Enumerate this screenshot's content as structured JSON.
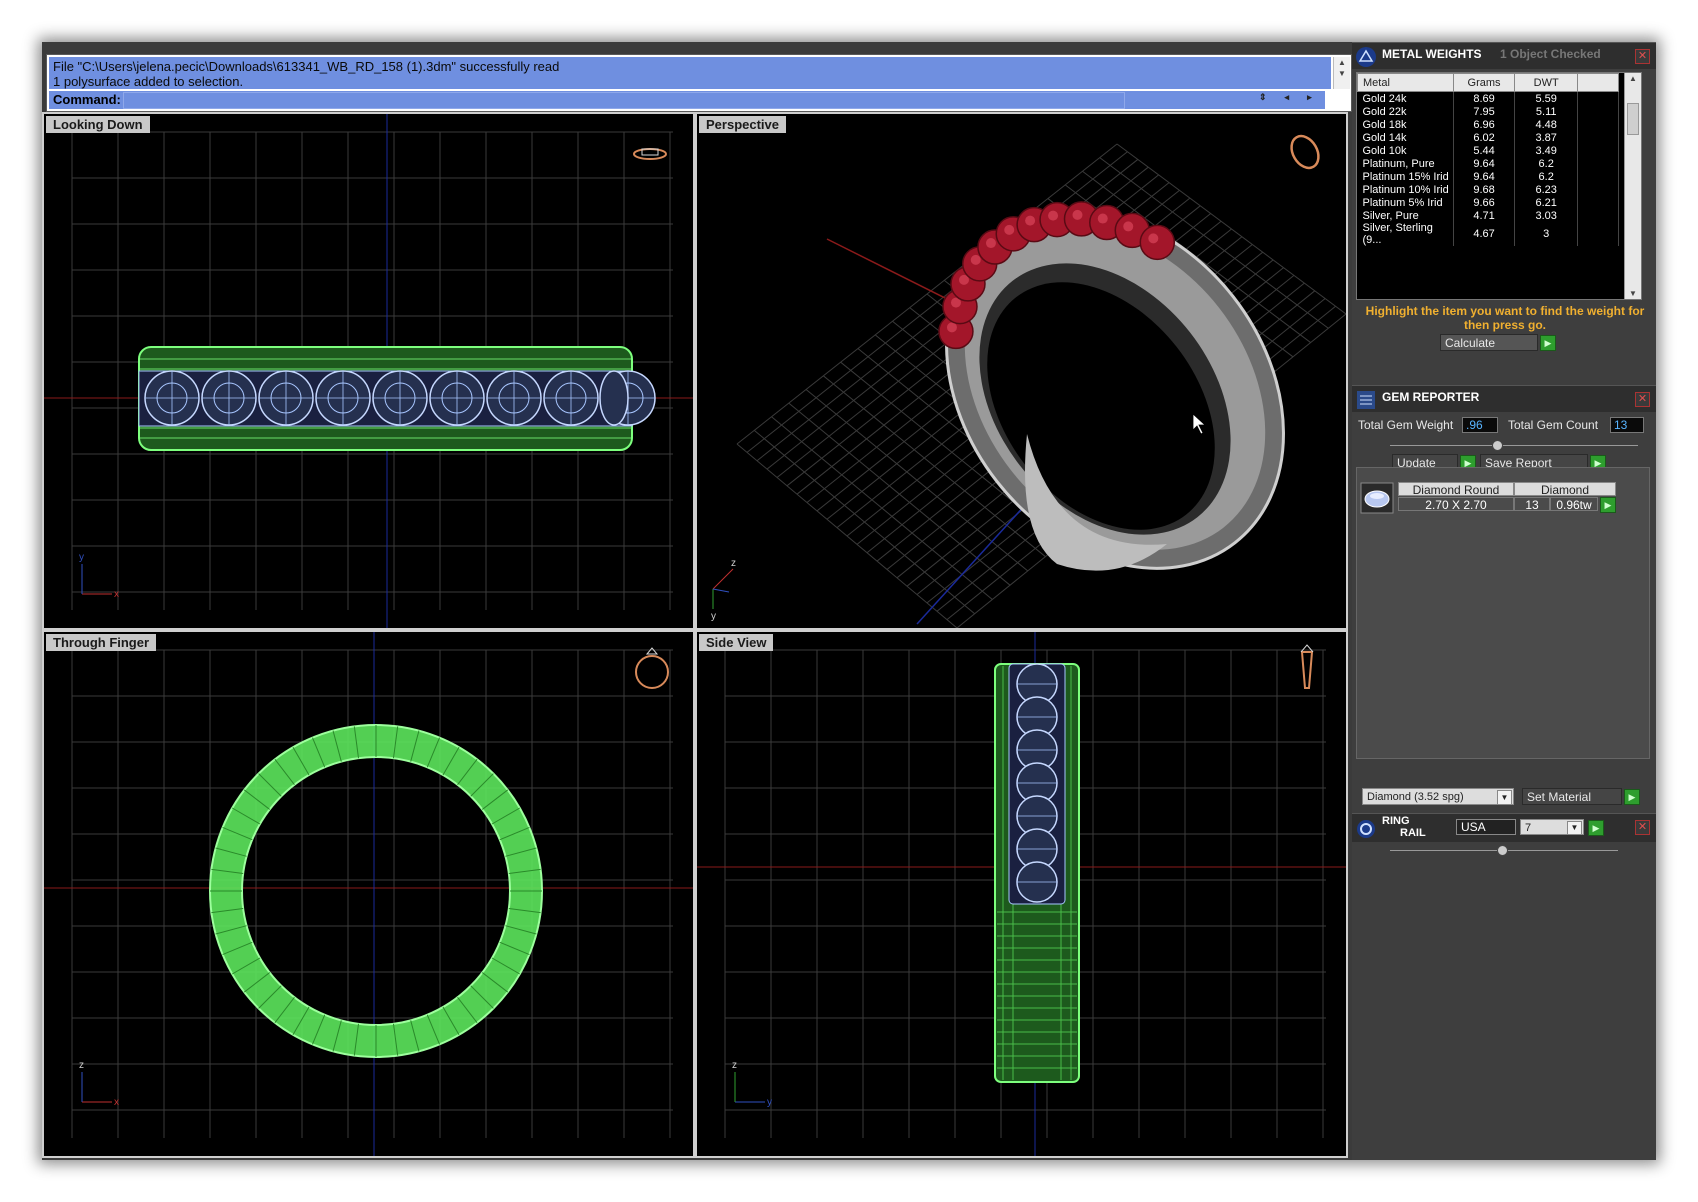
{
  "command": {
    "history": [
      "File \"C:\\Users\\jelena.pecic\\Downloads\\613341_WB_RD_158 (1).3dm\" successfully read",
      "1 polysurface added to selection."
    ],
    "label": "Command:"
  },
  "viewports": {
    "top": "Looking Down",
    "perspective": "Perspective",
    "front": "Through Finger",
    "side": "Side View"
  },
  "axes": {
    "x": "x",
    "y": "y",
    "z": "z"
  },
  "metal_weights": {
    "title": "METAL WEIGHTS",
    "status": "1 Object Checked",
    "columns": [
      "Metal",
      "Grams",
      "DWT"
    ],
    "rows": [
      [
        "Gold 24k",
        "8.69",
        "5.59"
      ],
      [
        "Gold 22k",
        "7.95",
        "5.11"
      ],
      [
        "Gold 18k",
        "6.96",
        "4.48"
      ],
      [
        "Gold 14k",
        "6.02",
        "3.87"
      ],
      [
        "Gold 10k",
        "5.44",
        "3.49"
      ],
      [
        "Platinum, Pure",
        "9.64",
        "6.2"
      ],
      [
        "Platinum 15% Irid",
        "9.64",
        "6.2"
      ],
      [
        "Platinum 10% Irid",
        "9.68",
        "6.23"
      ],
      [
        "Platinum 5% Irid",
        "9.66",
        "6.21"
      ],
      [
        "Silver, Pure",
        "4.71",
        "3.03"
      ],
      [
        "Silver, Sterling (9...",
        "4.67",
        "3"
      ]
    ],
    "hint": "Highlight the item you want to find the weight for then press go.",
    "calculate_label": "Calculate"
  },
  "gem_reporter": {
    "title": "GEM REPORTER",
    "total_weight_label": "Total Gem Weight",
    "total_weight_value": ".96",
    "total_count_label": "Total Gem Count",
    "total_count_value": "13",
    "update_label": "Update",
    "save_report_label": "Save Report",
    "gem": {
      "shape_header": "Diamond Round",
      "material_header": "Diamond",
      "size": "2.70 X 2.70",
      "count": "13",
      "weight": "0.96tw"
    },
    "material_select": "Diamond    (3.52 spg)",
    "set_material_label": "Set Material"
  },
  "ring_rail": {
    "title_line1": "RING",
    "title_line2": "RAIL",
    "standard": "USA",
    "size": "7"
  },
  "colors": {
    "command_bg": "#6f8fe0",
    "metal_wire": "#5ce65c",
    "gem_wire": "#a8c6ff",
    "ruby": "#a3162a",
    "hint_text": "#f0b030"
  }
}
